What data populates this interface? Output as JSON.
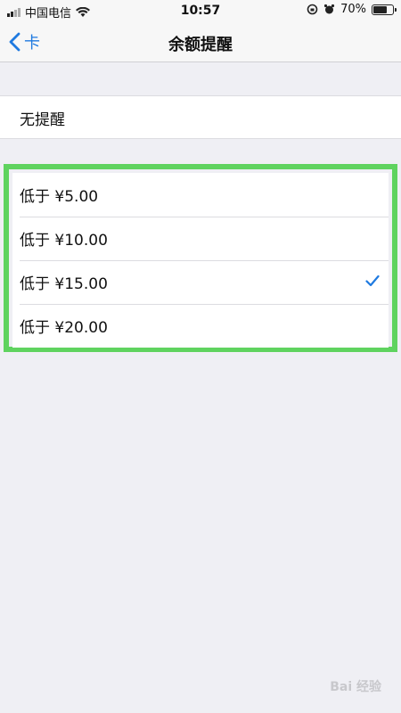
{
  "status_bar": {
    "carrier": "中国电信",
    "time": "10:57",
    "battery": "70%",
    "battery_level": 0.7
  },
  "nav": {
    "back_label": "卡",
    "title": "余额提醒"
  },
  "no_reminder_label": "无提醒",
  "options": [
    {
      "label": "低于 ¥5.00",
      "selected": false
    },
    {
      "label": "低于 ¥10.00",
      "selected": false
    },
    {
      "label": "低于 ¥15.00",
      "selected": true
    },
    {
      "label": "低于 ¥20.00",
      "selected": false
    }
  ],
  "watermark": "Bai 经验",
  "colors": {
    "accent": "#1f7ae0",
    "highlight": "#5fd35f",
    "background": "#efeff4"
  }
}
